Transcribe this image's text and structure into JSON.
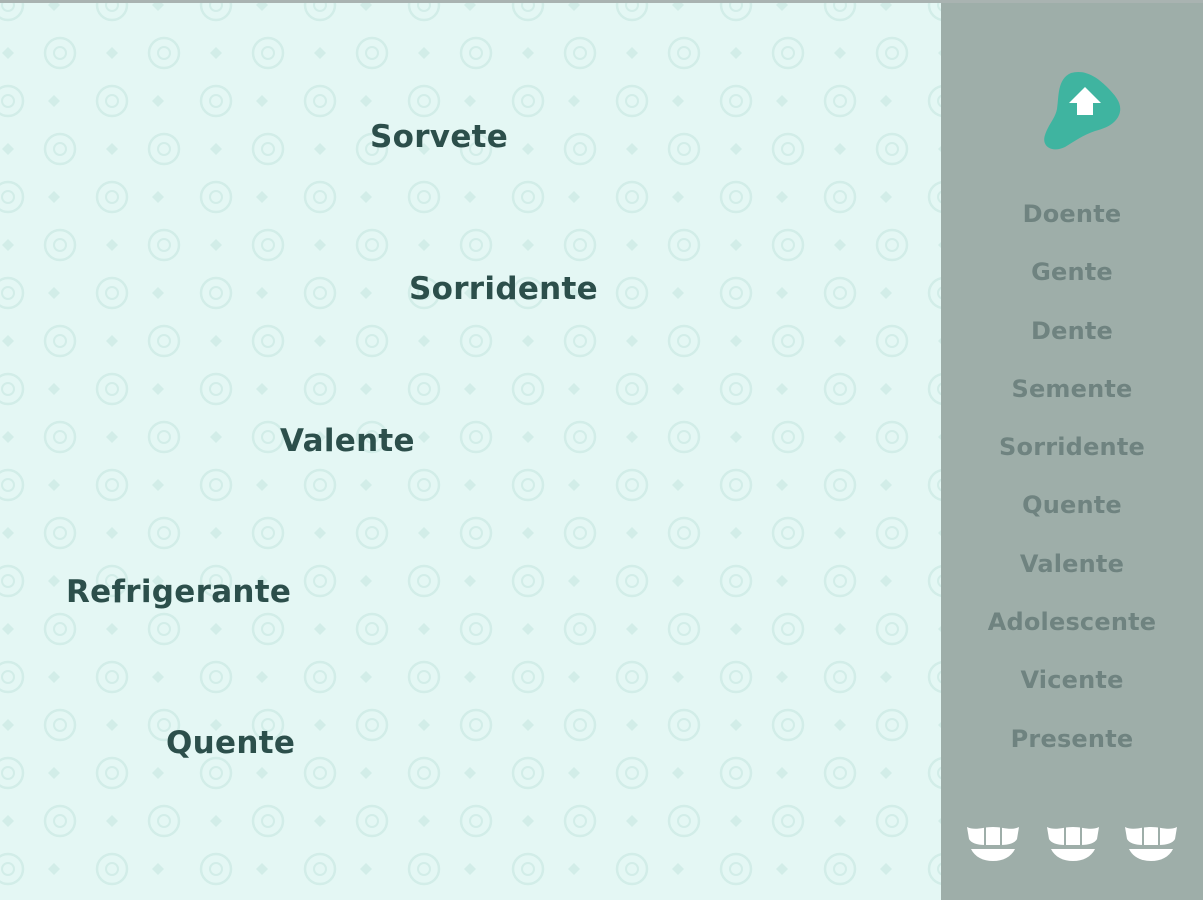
{
  "colors": {
    "background": "#e4f7f4",
    "word_text": "#2c4f4b",
    "sidebar_bg": "#9eaea9",
    "sidebar_text": "#6f8380",
    "home_button": "#3fb4a0",
    "lives_icon": "#ffffff"
  },
  "falling_words": [
    {
      "label": "Sorvete"
    },
    {
      "label": "Sorridente"
    },
    {
      "label": "Valente"
    },
    {
      "label": "Refrigerante"
    },
    {
      "label": "Quente"
    }
  ],
  "sidebar": {
    "home_icon": "home-arrow-icon",
    "words": [
      {
        "label": "Doente"
      },
      {
        "label": "Gente"
      },
      {
        "label": "Dente"
      },
      {
        "label": "Semente"
      },
      {
        "label": "Sorridente"
      },
      {
        "label": "Quente"
      },
      {
        "label": "Valente"
      },
      {
        "label": "Adolescente"
      },
      {
        "label": "Vicente"
      },
      {
        "label": "Presente"
      }
    ],
    "lives": {
      "count": 3,
      "icon": "tooth-icon"
    }
  }
}
